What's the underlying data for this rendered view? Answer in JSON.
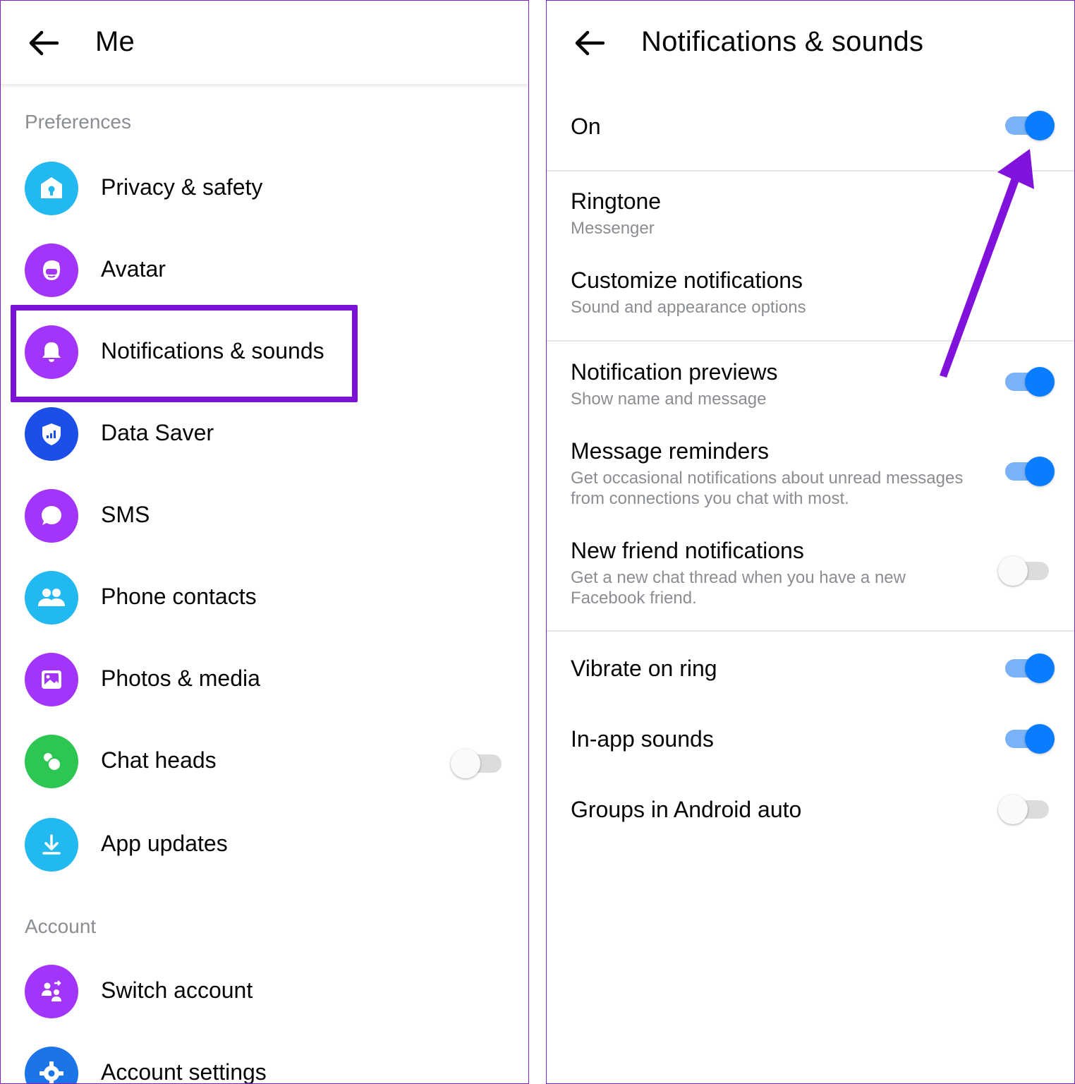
{
  "left": {
    "title": "Me",
    "preferences_label": "Preferences",
    "account_label": "Account",
    "items": [
      {
        "label": "Privacy & safety",
        "icon": "privacy-lock-icon",
        "color": "#22b8f0"
      },
      {
        "label": "Avatar",
        "icon": "avatar-face-icon",
        "color": "#a334fa"
      },
      {
        "label": "Notifications & sounds",
        "icon": "bell-icon",
        "color": "#a334fa"
      },
      {
        "label": "Data Saver",
        "icon": "data-shield-icon",
        "color": "#1b4fe8"
      },
      {
        "label": "SMS",
        "icon": "chat-bubble-icon",
        "color": "#a334fa"
      },
      {
        "label": "Phone contacts",
        "icon": "contacts-icon",
        "color": "#22b8f0"
      },
      {
        "label": "Photos & media",
        "icon": "photo-icon",
        "color": "#a334fa"
      },
      {
        "label": "Chat heads",
        "icon": "chat-heads-icon",
        "color": "#2dc653"
      },
      {
        "label": "App updates",
        "icon": "download-icon",
        "color": "#22b8f0"
      }
    ],
    "chat_heads_enabled": false,
    "account_items": [
      {
        "label": "Switch account",
        "icon": "switch-account-icon",
        "color": "#a334fa"
      },
      {
        "label": "Account settings",
        "icon": "gear-icon",
        "color": "#1b74e8"
      }
    ]
  },
  "right": {
    "title": "Notifications & sounds",
    "on_label": "On",
    "on_enabled": true,
    "ringtone": {
      "title": "Ringtone",
      "subtitle": "Messenger"
    },
    "customize": {
      "title": "Customize notifications",
      "subtitle": "Sound and appearance options"
    },
    "previews": {
      "title": "Notification previews",
      "subtitle": "Show name and message",
      "enabled": true
    },
    "reminders": {
      "title": "Message reminders",
      "subtitle": "Get occasional notifications about unread messages from connections you chat with most.",
      "enabled": true
    },
    "new_friend": {
      "title": "New friend notifications",
      "subtitle": "Get a new chat thread when you have a new Facebook friend.",
      "enabled": false
    },
    "vibrate": {
      "title": "Vibrate on ring",
      "enabled": true
    },
    "in_app": {
      "title": "In-app sounds",
      "enabled": true
    },
    "android_auto": {
      "title": "Groups in Android auto",
      "enabled": false
    }
  },
  "colors": {
    "highlight": "#7b12d6",
    "toggle_on": "#0a7cff",
    "toggle_on_track": "#7ab2f7",
    "arrow": "#8112db"
  }
}
